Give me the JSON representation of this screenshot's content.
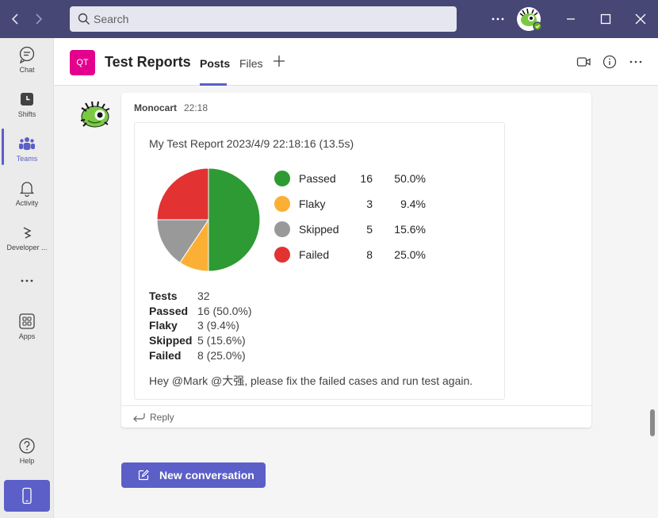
{
  "search": {
    "placeholder": "Search"
  },
  "rail": {
    "items": [
      {
        "label": "Chat",
        "icon": "chat-icon"
      },
      {
        "label": "Shifts",
        "icon": "shifts-icon"
      },
      {
        "label": "Teams",
        "icon": "teams-icon"
      },
      {
        "label": "Activity",
        "icon": "bell-icon"
      },
      {
        "label": "Developer ...",
        "icon": "developer-portal-icon"
      },
      {
        "label": "",
        "icon": "more-apps-icon"
      },
      {
        "label": "Apps",
        "icon": "apps-icon"
      },
      {
        "label": "Help",
        "icon": "help-icon"
      }
    ],
    "active": "Teams"
  },
  "channel": {
    "badge": "QT",
    "title": "Test Reports",
    "tabs": [
      {
        "label": "Posts"
      },
      {
        "label": "Files"
      }
    ]
  },
  "message": {
    "sender": "Monocart",
    "time": "22:18",
    "card": {
      "title": "My Test Report 2023/4/9 22:18:16 (13.5s)",
      "legend": [
        {
          "name": "Passed",
          "count": "16",
          "percent": "50.0%",
          "color": "#2e9a33"
        },
        {
          "name": "Flaky",
          "count": "3",
          "percent": "9.4%",
          "color": "#fbb035"
        },
        {
          "name": "Skipped",
          "count": "5",
          "percent": "15.6%",
          "color": "#999999"
        },
        {
          "name": "Failed",
          "count": "8",
          "percent": "25.0%",
          "color": "#e33232"
        }
      ],
      "stats": [
        {
          "label": "Tests",
          "value": "32"
        },
        {
          "label": "Passed",
          "value": "16 (50.0%)"
        },
        {
          "label": "Flaky",
          "value": "3 (9.4%)"
        },
        {
          "label": "Skipped",
          "value": "5 (15.6%)"
        },
        {
          "label": "Failed",
          "value": "8 (25.0%)"
        }
      ],
      "mention_text": "Hey @Mark @大强, please fix the failed cases and run test again."
    },
    "reply_label": "Reply"
  },
  "new_conversation_label": "New conversation",
  "chart_data": {
    "type": "pie",
    "categories": [
      "Passed",
      "Flaky",
      "Skipped",
      "Failed"
    ],
    "values": [
      16,
      3,
      5,
      8
    ],
    "colors": [
      "#2e9a33",
      "#fbb035",
      "#999999",
      "#e33232"
    ]
  },
  "colors": {
    "brand": "#5b5fc7",
    "topbar": "#464775",
    "team_badge": "#e3008c"
  }
}
